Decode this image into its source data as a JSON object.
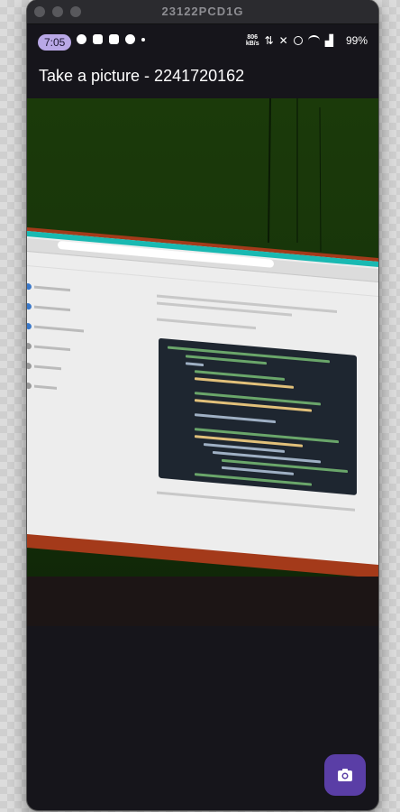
{
  "window": {
    "title": "23122PCD1G"
  },
  "status_bar": {
    "time": "7:05",
    "network_speed_value": "806",
    "network_speed_unit": "kB/s",
    "battery": "99%"
  },
  "app_bar": {
    "title": "Take a picture - 2241720162"
  },
  "fab": {
    "icon": "camera-icon"
  }
}
